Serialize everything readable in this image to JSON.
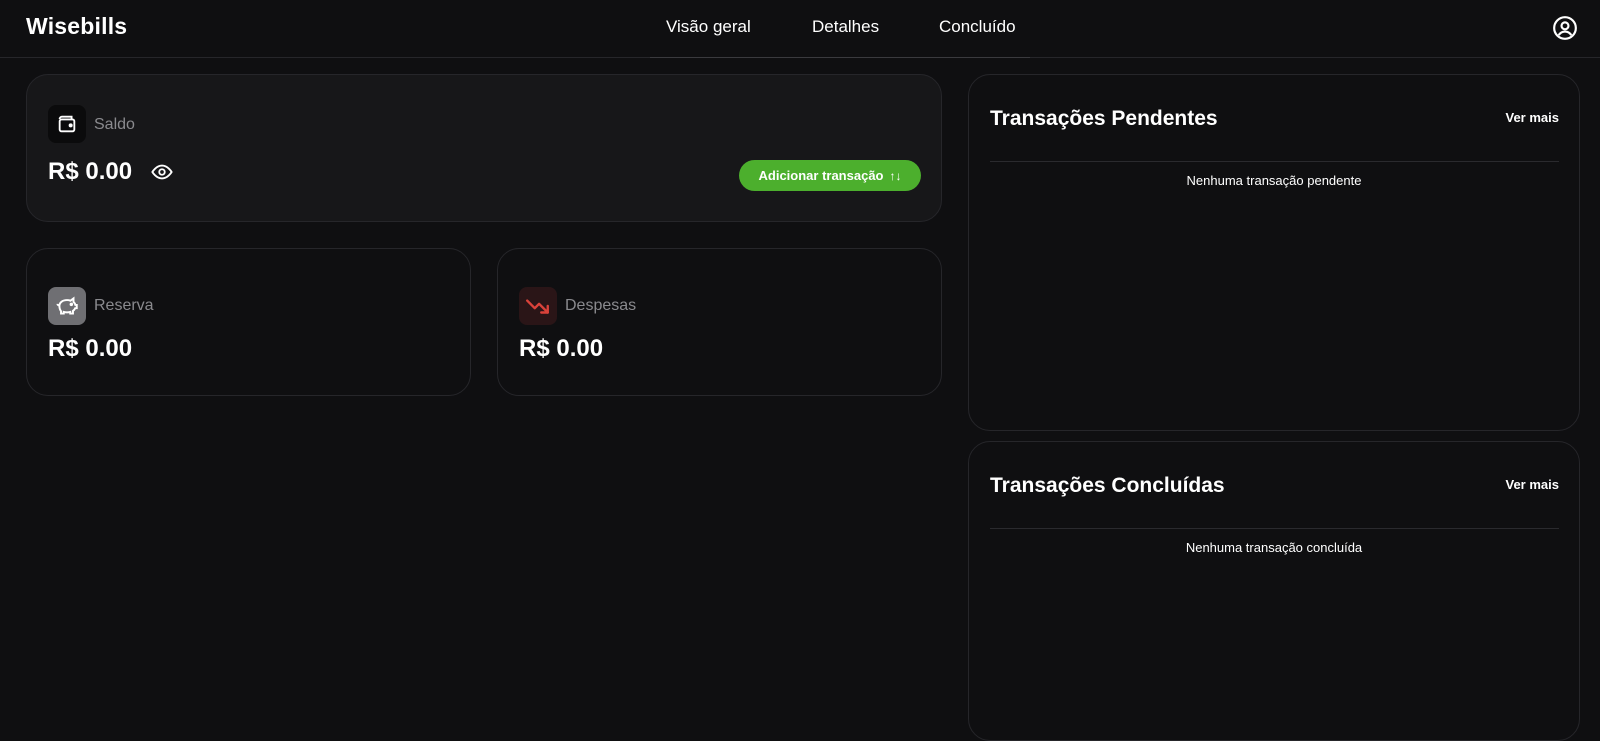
{
  "app": {
    "title": "Wisebills"
  },
  "nav": {
    "tabs": [
      {
        "label": "Visão geral"
      },
      {
        "label": "Detalhes"
      },
      {
        "label": "Concluído"
      }
    ]
  },
  "balance": {
    "label": "Saldo",
    "amount": "R$ 0.00",
    "add_button_label": "Adicionar transação",
    "add_button_icon": "↑↓"
  },
  "reserve": {
    "label": "Reserva",
    "amount": "R$ 0.00"
  },
  "expenses": {
    "label": "Despesas",
    "amount": "R$ 0.00"
  },
  "pending": {
    "title": "Transações Pendentes",
    "link": "Ver mais",
    "empty_text": "Nenhuma transação pendente"
  },
  "completed": {
    "title": "Transações Concluídas",
    "link": "Ver mais",
    "empty_text": "Nenhuma transação concluída"
  },
  "colors": {
    "accent_green": "#4caf2d",
    "expense_red": "#d9423a",
    "background": "#0f0f11"
  },
  "icons": {
    "balance": "wallet-icon",
    "reserve": "piggy-bank-icon",
    "expenses": "trending-down-icon",
    "visibility": "eye-icon",
    "user": "user-circle-icon"
  }
}
